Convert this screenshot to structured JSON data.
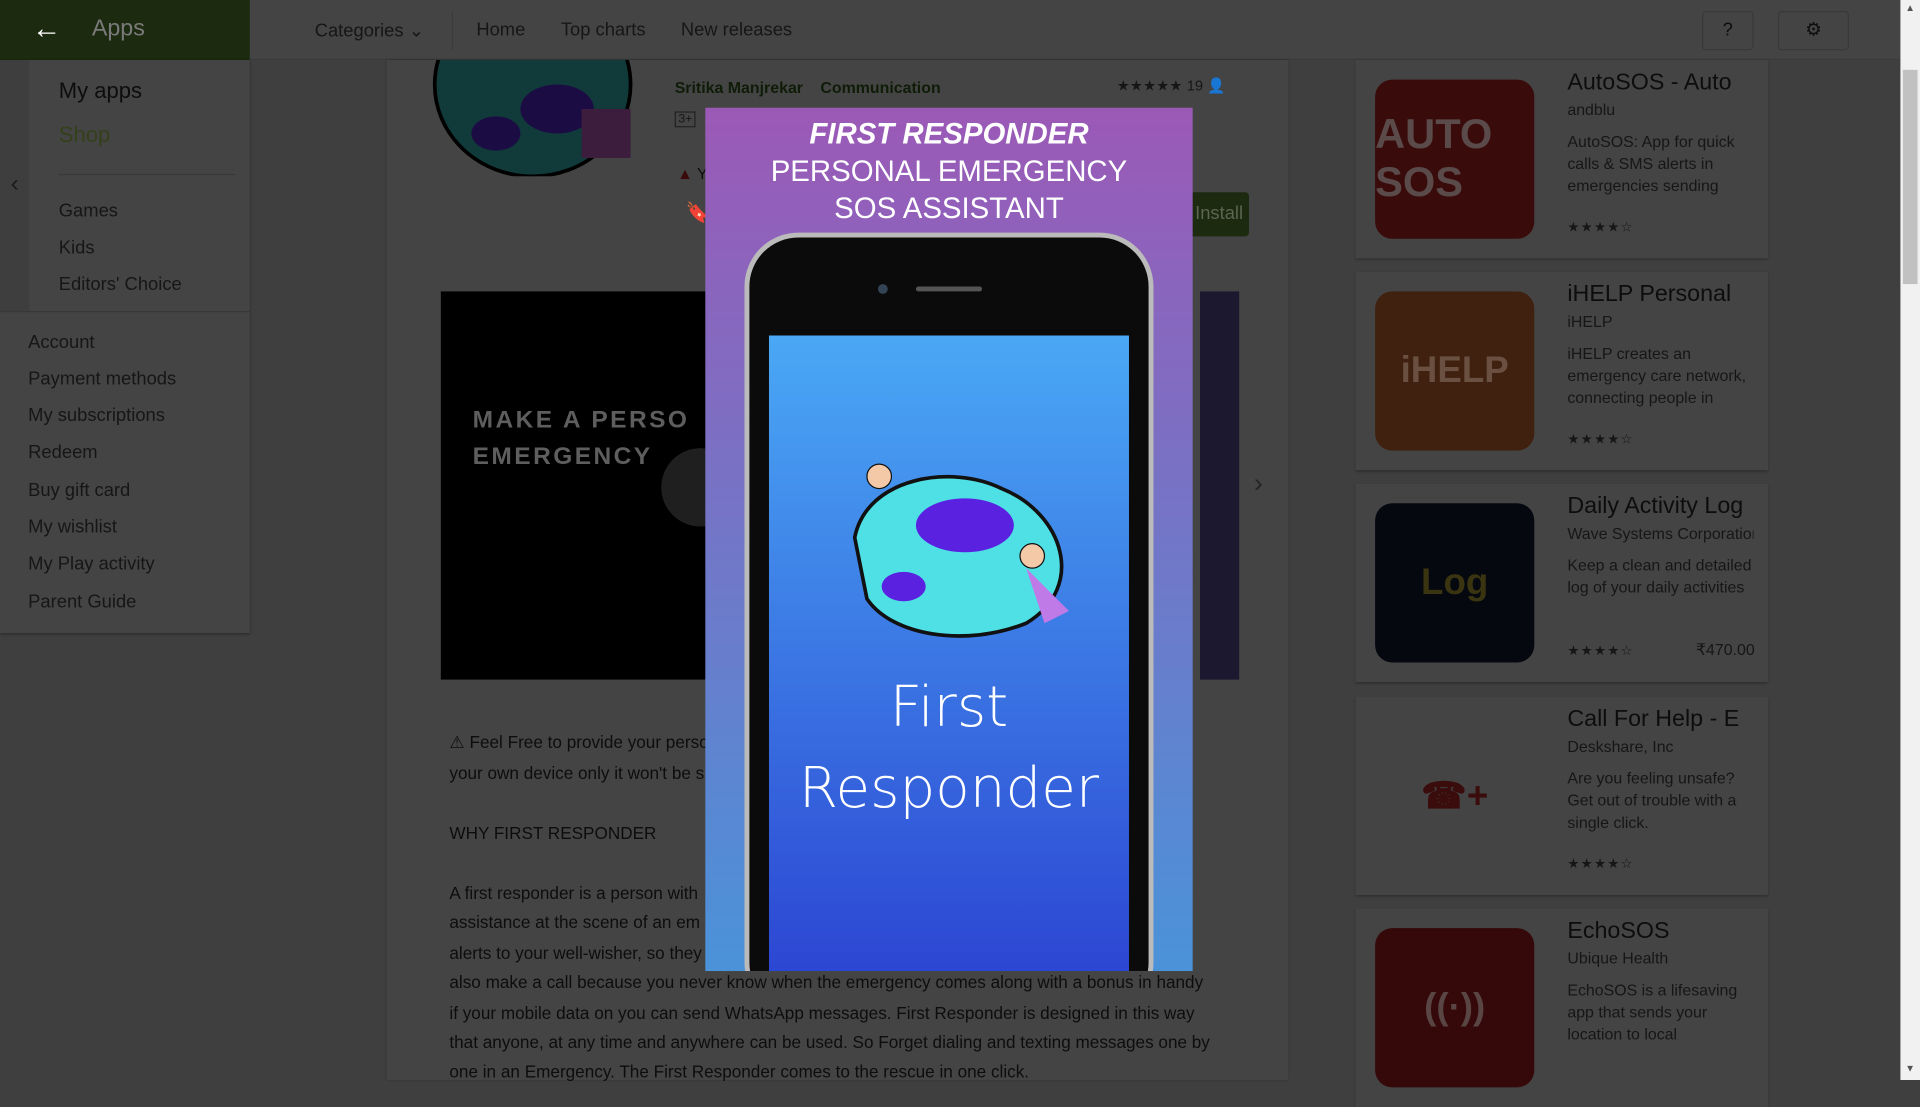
{
  "topbar": {
    "brand": "Apps",
    "nav": [
      "Categories",
      "Home",
      "Top charts",
      "New releases"
    ],
    "help_icon": "help-icon",
    "settings_icon": "gear-icon"
  },
  "sidebar": {
    "main": [
      "My apps",
      "Shop"
    ],
    "sub": [
      "Games",
      "Kids",
      "Editors' Choice"
    ],
    "account": [
      "Account",
      "Payment methods",
      "My subscriptions",
      "Redeem",
      "Buy gift card",
      "My wishlist",
      "My Play activity",
      "Parent Guide"
    ]
  },
  "app": {
    "developer": "Sritika Manjrekar",
    "category": "Communication",
    "stars": "★★★★★",
    "rating_count": "19",
    "age": "3+",
    "warning": "Y",
    "install": "Install",
    "video_text": "MAKE A PERSO\nEMERGENCY"
  },
  "description": [
    "⚠ Feel Free to provide your perso",
    "your own device only it won't be s",
    "WHY FIRST RESPONDER",
    "A first responder is a person with",
    "assistance at the scene of an em",
    "alerts to your well-wisher, so they",
    "also make a call because you never know when the emergency comes along with a bonus in handy",
    "if your mobile data on you can send WhatsApp messages. First Responder is designed in this way",
    "that anyone, at any time and anywhere can be used. So Forget dialing and texting messages one by",
    "one in an Emergency. The First Responder comes to the rescue in one click."
  ],
  "similar": [
    {
      "name": "AutoSOS - Auto",
      "dev": "andblu",
      "desc": "AutoSOS: App for quick calls & SMS alerts in emergencies sending links",
      "stars": "★★★★☆",
      "price": "",
      "icon": "AUTO SOS",
      "color": "#c62828"
    },
    {
      "name": "iHELP Personal",
      "dev": "iHELP",
      "desc": "iHELP creates an emergency care network, connecting people in",
      "stars": "★★★★☆",
      "price": "",
      "icon": "iHELP",
      "color": "#e65a1e"
    },
    {
      "name": "Daily Activity Log",
      "dev": "Wave Systems Corporation",
      "desc": "Keep a clean and detailed log of your daily activities",
      "stars": "★★★★☆",
      "price": "₹470.00",
      "icon": "Log",
      "color": "#0d1b3a"
    },
    {
      "name": "Call For Help - E",
      "dev": "Deskshare, Inc",
      "desc": "Are you feeling unsafe? Get out of trouble with a single click.",
      "stars": "★★★★☆",
      "price": "",
      "icon": "☎+",
      "color": "#ffffff"
    },
    {
      "name": "EchoSOS",
      "dev": "Ubique Health",
      "desc": "EchoSOS is a lifesaving app that sends your location to local",
      "stars": "",
      "price": "",
      "icon": "((·))",
      "color": "#b71c1c"
    }
  ],
  "modal": {
    "title": "FIRST RESPONDER",
    "subtitle1": "PERSONAL EMERGENCY",
    "subtitle2": "SOS ASSISTANT",
    "screen_text1": "First",
    "screen_text2": "Responder"
  }
}
